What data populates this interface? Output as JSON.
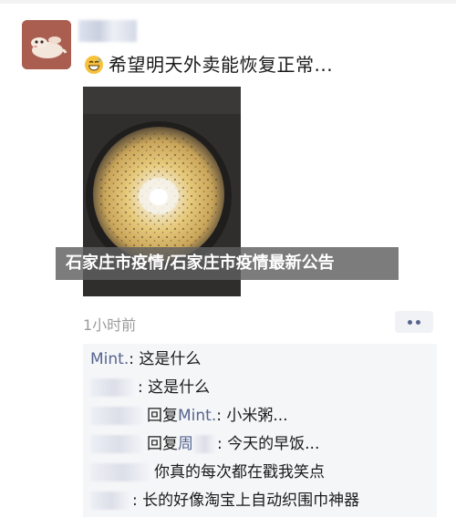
{
  "post": {
    "text": "希望明天外卖能恢复正常...",
    "emoji": "grinning-sweat-emoji",
    "time": "1小时前",
    "overlay_banner": "石家庄市疫情/石家庄市疫情最新公告"
  },
  "comments": [
    {
      "nickname": "Mint.",
      "text": ": 这是什么"
    },
    {
      "nickname": "",
      "text": ": 这是什么"
    },
    {
      "reply_word": "回复",
      "reply_to": "Mint.",
      "text": ": 小米粥..."
    },
    {
      "reply_word": "回复",
      "reply_to": "周",
      "text": ": 今天的早饭..."
    },
    {
      "nickname": "",
      "text": "你真的每次都在戳我笑点"
    },
    {
      "nickname": "",
      "text": ": 长的好像淘宝上自动织围巾神器"
    }
  ],
  "colors": {
    "nickname": "#56658f",
    "time": "#9b9b9b",
    "comment_bg": "#f5f6f8",
    "banner_bg": "#5f5f5f"
  },
  "icons": {
    "more": "more-dots-icon"
  }
}
